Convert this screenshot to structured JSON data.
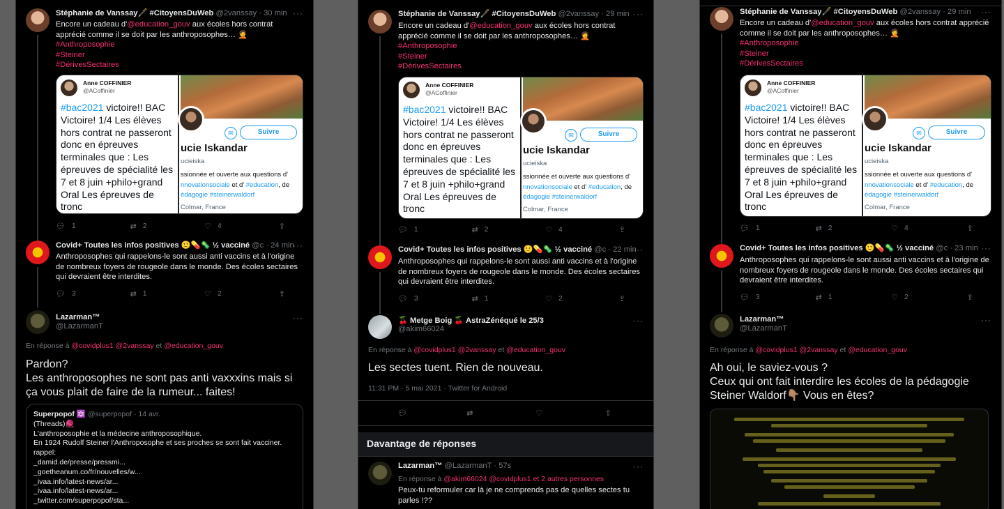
{
  "tweet_main": {
    "name": "Stéphanie de Vanssay🖋️ #CitoyensDuWeb",
    "handle": "@2vanssay",
    "text_a": "Encore un cadeau d'",
    "mention": "@education_gouv",
    "text_b": " aux écoles hors contrat  apprécié comme il se doit par les anthroposophes… 🤦",
    "tags": [
      "#Anthroposophie",
      "#Steiner",
      "#DérivesSectaires"
    ],
    "card": {
      "left_name": "Anne COFFINIER",
      "left_handle": "@ACoffinier",
      "left_hashtag": "#bac2021",
      "left_text": " victoire!! BAC Victoire! 1/4 Les élèves hors contrat ne passeront donc en épreuves terminales que : Les épreuves de spécialité les 7 et 8 juin +philo+grand Oral Les épreuves de tronc",
      "follow_label": "Suivre",
      "right_name": "ucie Iskandar",
      "right_handle": "ucieiska",
      "bio_1": "ssionnée et ouverte aux questions d'",
      "bio_2a": "nnovationsociale",
      "bio_2b": " et d' ",
      "bio_2c": "#education",
      "bio_2d": ", de",
      "bio_3a": "édagogie",
      "bio_3b": "#steinerwaldorf",
      "location": "Colmar, France"
    },
    "stats": {
      "reply": "1",
      "retweet": "2",
      "like": "4"
    }
  },
  "tweet_covid": {
    "name": "Covid+ Toutes les infos positives 🙂💊🦠 ½ vacciné",
    "handle": "@c",
    "text": "Anthroposophes qui rappelons-le sont aussi anti vaccins et à l'origine de nombreux foyers de rougeole dans le monde. Des écoles sectaires qui devraient être interdites.",
    "stats": {
      "reply": "3",
      "retweet": "1",
      "like": "2"
    }
  },
  "panel1": {
    "time_main": "30 min",
    "time_covid": "24 min",
    "laz_name": "Lazarman™",
    "laz_handle": "@LazarmanT",
    "reply_prefix": "En réponse à ",
    "reply_mentions_a": "@covidplus1 @2vanssay",
    "reply_and": "  et  ",
    "reply_mentions_b": "@education_gouv",
    "big_text_1": "Pardon?",
    "big_text_2": " Les anthroposophes ne sont pas anti vaxxxins mais si ça vous plait de faire de la rumeur... faites!",
    "quote_name": "Superpopof 🔯",
    "quote_handle": "@superpopof · 14 avr.",
    "quote_lines": [
      "(Threads)🧶",
      " L'anthroposophie et la médecine anthroposophique.",
      "En 1924 Rudolf Steiner l'Anthroposophe et ses proches se sont fait vacciner.",
      "rappel:",
      "_damid.de/presse/pressmi...",
      "_goetheanum.co/fr/nouvelles/w...",
      "_ivaa.info/latest-news/ar...",
      " _ivaa.info/latest-news/ar...",
      "_twitter.com/superpopof/sta..."
    ]
  },
  "panel2": {
    "time_main": "29 min",
    "time_covid": "22 min",
    "metge_name": "🍒 Metge Boig 🍒 AstraZénéqué le 25/3",
    "metge_handle": "@akim66024",
    "reply_prefix": "En réponse à ",
    "reply_mentions_a": "@covidplus1 @2vanssay",
    "reply_and": "  et  ",
    "reply_mentions_b": "@education_gouv",
    "big_text": "Les sectes tuent. Rien de nouveau.",
    "meta": "11:31 PM · 5 mai 2021 · Twitter for Android",
    "section": "Davantage de réponses",
    "laz_name": "Lazarman™",
    "laz_handle": "@LazarmanT · 57s",
    "laz_reply_prefix": "En réponse à ",
    "laz_reply_mentions": "@akim66024 @covidplus1",
    "laz_reply_and": "  et 2 autres personnes",
    "laz_text": "Peux-tu reformuler car là je ne comprends pas de quelles sectes tu parles !??"
  },
  "panel3": {
    "time_main": "29 min",
    "time_covid": "23 min",
    "laz_name": "Lazarman™",
    "laz_handle": "@LazarmanT",
    "reply_prefix": "En réponse à ",
    "reply_mentions_a": "@covidplus1 @2vanssay",
    "reply_and": "  et  ",
    "reply_mentions_b": "@education_gouv",
    "big_text": "Ah oui, le saviez-vous ?\n Ceux qui ont fait interdire les écoles de la pédagogie Steiner Waldorf👇🏽 Vous en êtes?"
  },
  "colors": {
    "accent": "#f4316f",
    "link": "#1d9bf0",
    "muted": "#71767b",
    "bg": "#000000"
  }
}
